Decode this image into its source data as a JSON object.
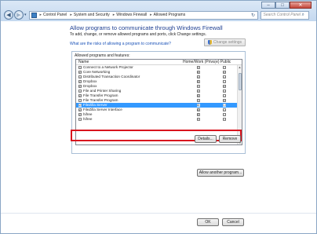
{
  "toolbar": {
    "back_icon": "back-arrow-icon",
    "forward_icon": "forward-arrow-icon",
    "breadcrumbs": [
      "Control Panel",
      "System and Security",
      "Windows Firewall",
      "Allowed Programs"
    ],
    "search_placeholder": "Search Control Panel"
  },
  "main": {
    "heading": "Allow programs to communicate through Windows Firewall",
    "subtext": "To add, change, or remove allowed programs and ports, click Change settings.",
    "risk_link": "What are the risks of allowing a program to communicate?",
    "change_settings_label": "Change settings",
    "group_label": "Allowed programs and features:",
    "columns": {
      "name": "Name",
      "home": "Home/Work (Private)",
      "public": "Public"
    },
    "programs": [
      {
        "name": "Connect to a Network Projector",
        "enabled": "☐",
        "home": "☐",
        "public": "☐"
      },
      {
        "name": "Core Networking",
        "enabled": "☑",
        "home": "☑",
        "public": "☑"
      },
      {
        "name": "Distributed Transaction Coordinator",
        "enabled": "☐",
        "home": "☐",
        "public": "☐"
      },
      {
        "name": "Dropbox",
        "enabled": "☑",
        "home": "☑",
        "public": "☐"
      },
      {
        "name": "Dropbox",
        "enabled": "☑",
        "home": "☐",
        "public": "☑"
      },
      {
        "name": "File and Printer Sharing",
        "enabled": "☐",
        "home": "☐",
        "public": "☐"
      },
      {
        "name": "File Transfer Program",
        "enabled": "☑",
        "home": "☑",
        "public": "☐"
      },
      {
        "name": "File Transfer Program",
        "enabled": "☐",
        "home": "☐",
        "public": "☑"
      },
      {
        "name": "FileZilla Server",
        "enabled": "☑",
        "home": "☑",
        "public": "☐"
      },
      {
        "name": "FileZilla Server Interface",
        "enabled": "☑",
        "home": "☑",
        "public": "☐"
      },
      {
        "name": "hifree",
        "enabled": "☑",
        "home": "☑",
        "public": "☐"
      },
      {
        "name": "hifree",
        "enabled": "☐",
        "home": "☐",
        "public": "☐"
      }
    ],
    "details_label": "Details...",
    "remove_label": "Remove",
    "allow_another_label": "Allow another program..."
  },
  "footer": {
    "ok_label": "OK",
    "cancel_label": "Cancel"
  },
  "colors": {
    "heading": "#1e3f92",
    "selection": "#3399ff",
    "highlight_box": "#d9151e",
    "link": "#1a52b8"
  }
}
